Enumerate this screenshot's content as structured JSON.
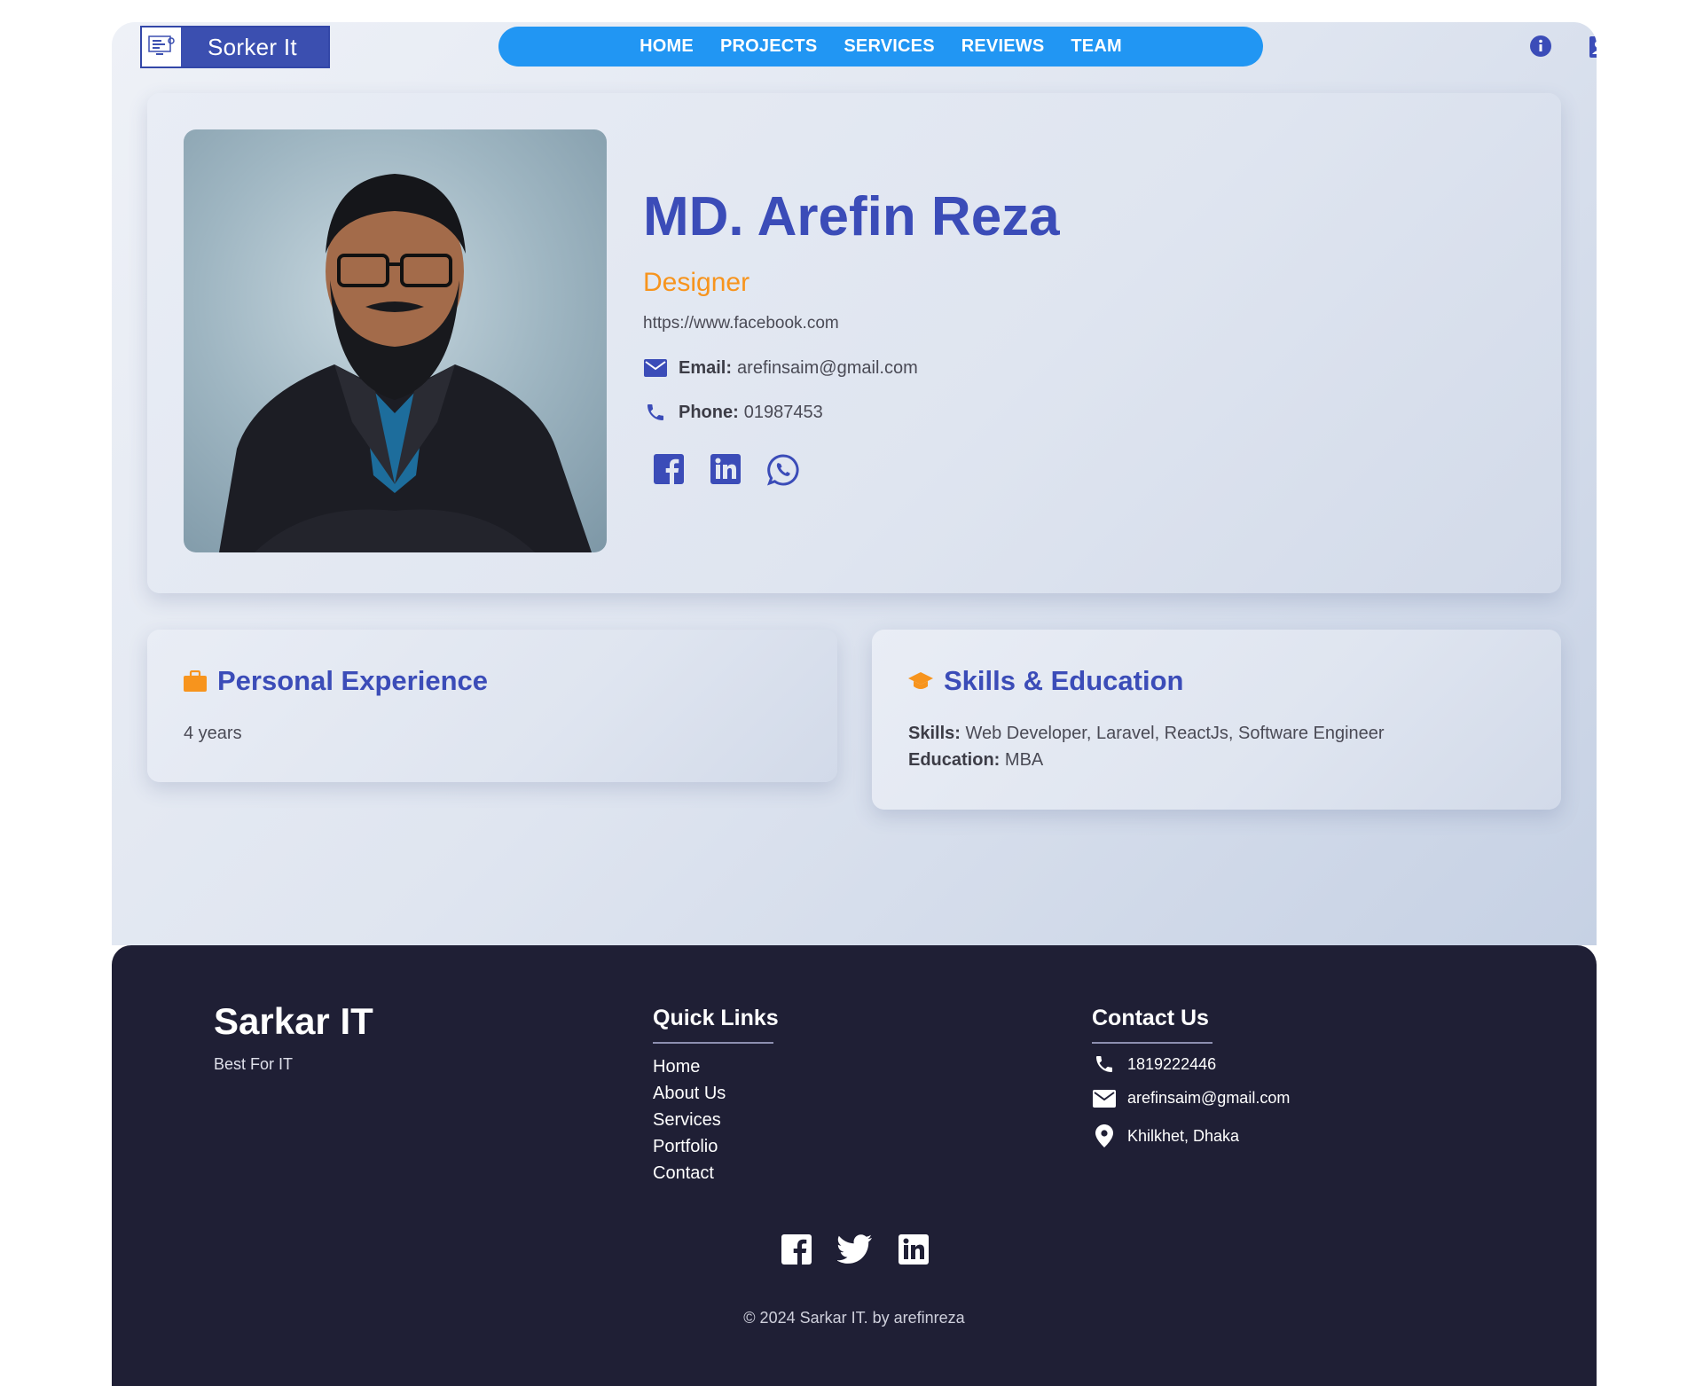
{
  "header": {
    "logo_text": "Sorker It",
    "nav": [
      "HOME",
      "PROJECTS",
      "SERVICES",
      "REVIEWS",
      "TEAM"
    ],
    "icons": [
      "info-icon",
      "contact-card-icon"
    ]
  },
  "profile": {
    "name": "MD. Arefin Reza",
    "role": "Designer",
    "url": "https://www.facebook.com",
    "email_label": "Email:",
    "email": "arefinsaim@gmail.com",
    "phone_label": "Phone:",
    "phone": "01987453",
    "socials": [
      "facebook-icon",
      "linkedin-icon",
      "whatsapp-icon"
    ]
  },
  "experience": {
    "title": "Personal Experience",
    "value": "4 years"
  },
  "skills_education": {
    "title": "Skills & Education",
    "skills_label": "Skills:",
    "skills": "Web Developer, Laravel, ReactJs, Software Engineer",
    "education_label": "Education:",
    "education": "MBA"
  },
  "footer": {
    "brand": "Sarkar IT",
    "tagline": "Best For IT",
    "quick_links_title": "Quick Links",
    "quick_links": [
      "Home",
      "About Us",
      "Services",
      "Portfolio",
      "Contact"
    ],
    "contact_title": "Contact Us",
    "phone": "1819222446",
    "email": "arefinsaim@gmail.com",
    "address": "Khilkhet, Dhaka",
    "socials": [
      "facebook-icon",
      "twitter-icon",
      "linkedin-icon"
    ],
    "copyright": "© 2024 Sarkar IT. by arefinreza"
  },
  "colors": {
    "accent": "#3b4cb8",
    "nav_bg": "#2196f3",
    "role": "#f7941d",
    "footer_bg": "#1f1f35"
  }
}
